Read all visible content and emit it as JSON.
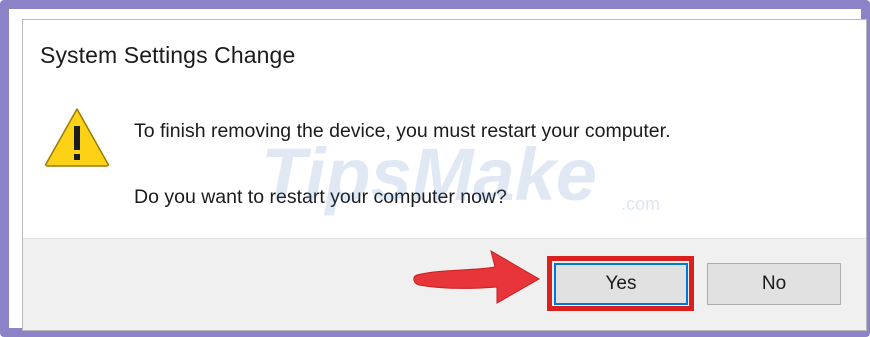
{
  "dialog": {
    "title": "System Settings Change",
    "message_line1": "To finish removing the device, you must restart your computer.",
    "message_line2": "Do you want to restart your computer now?",
    "icon": "warning-triangle-icon"
  },
  "buttons": {
    "yes_label": "Yes",
    "no_label": "No"
  },
  "watermark": {
    "text": "TipsMake",
    "suffix": ".com"
  },
  "colors": {
    "frame": "#8c82c8",
    "warning_yellow": "#fcd116",
    "highlight_red": "#d8201f",
    "arrow_red": "#e8353a",
    "focus_blue": "#0078d7",
    "footer_bg": "#f0f0f0"
  }
}
